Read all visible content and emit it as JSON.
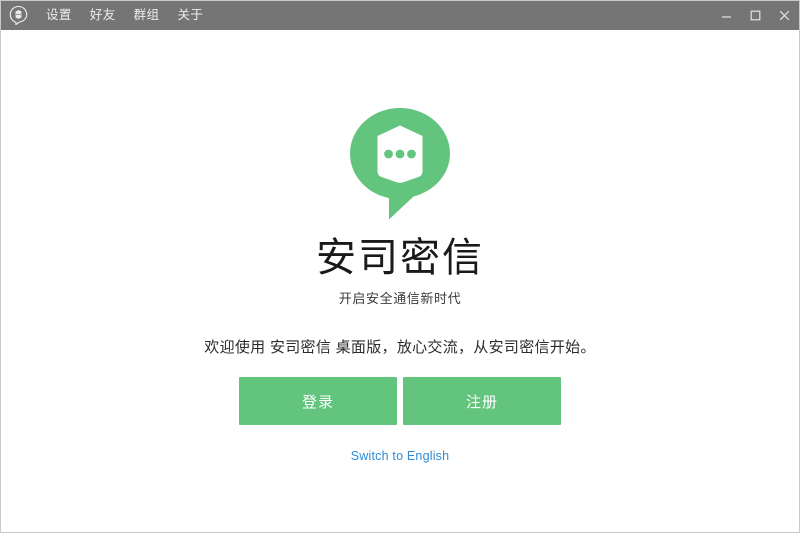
{
  "window": {
    "app_icon": "chat-bubble-icon",
    "menu": [
      {
        "id": "settings",
        "label": "设置"
      },
      {
        "id": "friends",
        "label": "好友"
      },
      {
        "id": "groups",
        "label": "群组"
      },
      {
        "id": "about",
        "label": "关于"
      }
    ],
    "controls": {
      "minimize": "minimize-icon",
      "maximize": "maximize-icon",
      "close": "close-icon"
    }
  },
  "main": {
    "logo_icon": "shield-chat-bubble-logo",
    "title": "安司密信",
    "subtitle": "开启安全通信新时代",
    "welcome": "欢迎使用 安司密信 桌面版，放心交流，从安司密信开始。",
    "buttons": [
      {
        "id": "login",
        "label": "登录"
      },
      {
        "id": "register",
        "label": "注册"
      }
    ],
    "language_link": "Switch to English"
  },
  "colors": {
    "titlebar_bg": "#757575",
    "brand_green": "#63c47e",
    "link_blue": "#2e8bd6",
    "page_bg": "#ffffff",
    "title_text": "#1a1a1a"
  }
}
